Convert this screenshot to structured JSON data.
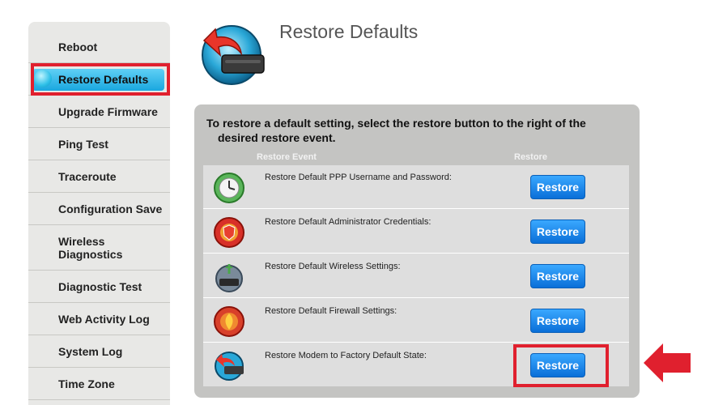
{
  "sidebar": {
    "items": [
      {
        "label": "Reboot"
      },
      {
        "label": "Restore Defaults",
        "active": true
      },
      {
        "label": "Upgrade Firmware"
      },
      {
        "label": "Ping Test"
      },
      {
        "label": "Traceroute"
      },
      {
        "label": "Configuration Save"
      },
      {
        "label": "Wireless Diagnostics"
      },
      {
        "label": "Diagnostic Test"
      },
      {
        "label": "Web Activity Log"
      },
      {
        "label": "System Log"
      },
      {
        "label": "Time Zone"
      }
    ]
  },
  "page": {
    "title": "Restore Defaults",
    "instruction_line1": "To restore a default setting, select the restore button to the right of the",
    "instruction_line2": "desired restore event."
  },
  "table": {
    "col_event": "Restore Event",
    "col_restore": "Restore",
    "rows": [
      {
        "label": "Restore Default PPP Username and Password:",
        "button": "Restore",
        "icon": "clock-icon"
      },
      {
        "label": "Restore Default Administrator Credentials:",
        "button": "Restore",
        "icon": "admin-shield-icon"
      },
      {
        "label": "Restore Default Wireless Settings:",
        "button": "Restore",
        "icon": "wireless-router-icon"
      },
      {
        "label": "Restore Default Firewall Settings:",
        "button": "Restore",
        "icon": "firewall-icon"
      },
      {
        "label": "Restore Modem to Factory Default State:",
        "button": "Restore",
        "icon": "modem-restore-icon"
      }
    ]
  },
  "colors": {
    "accent_blue": "#1aa7df",
    "button_blue": "#0a6fd8",
    "highlight_red": "#e0202e"
  }
}
